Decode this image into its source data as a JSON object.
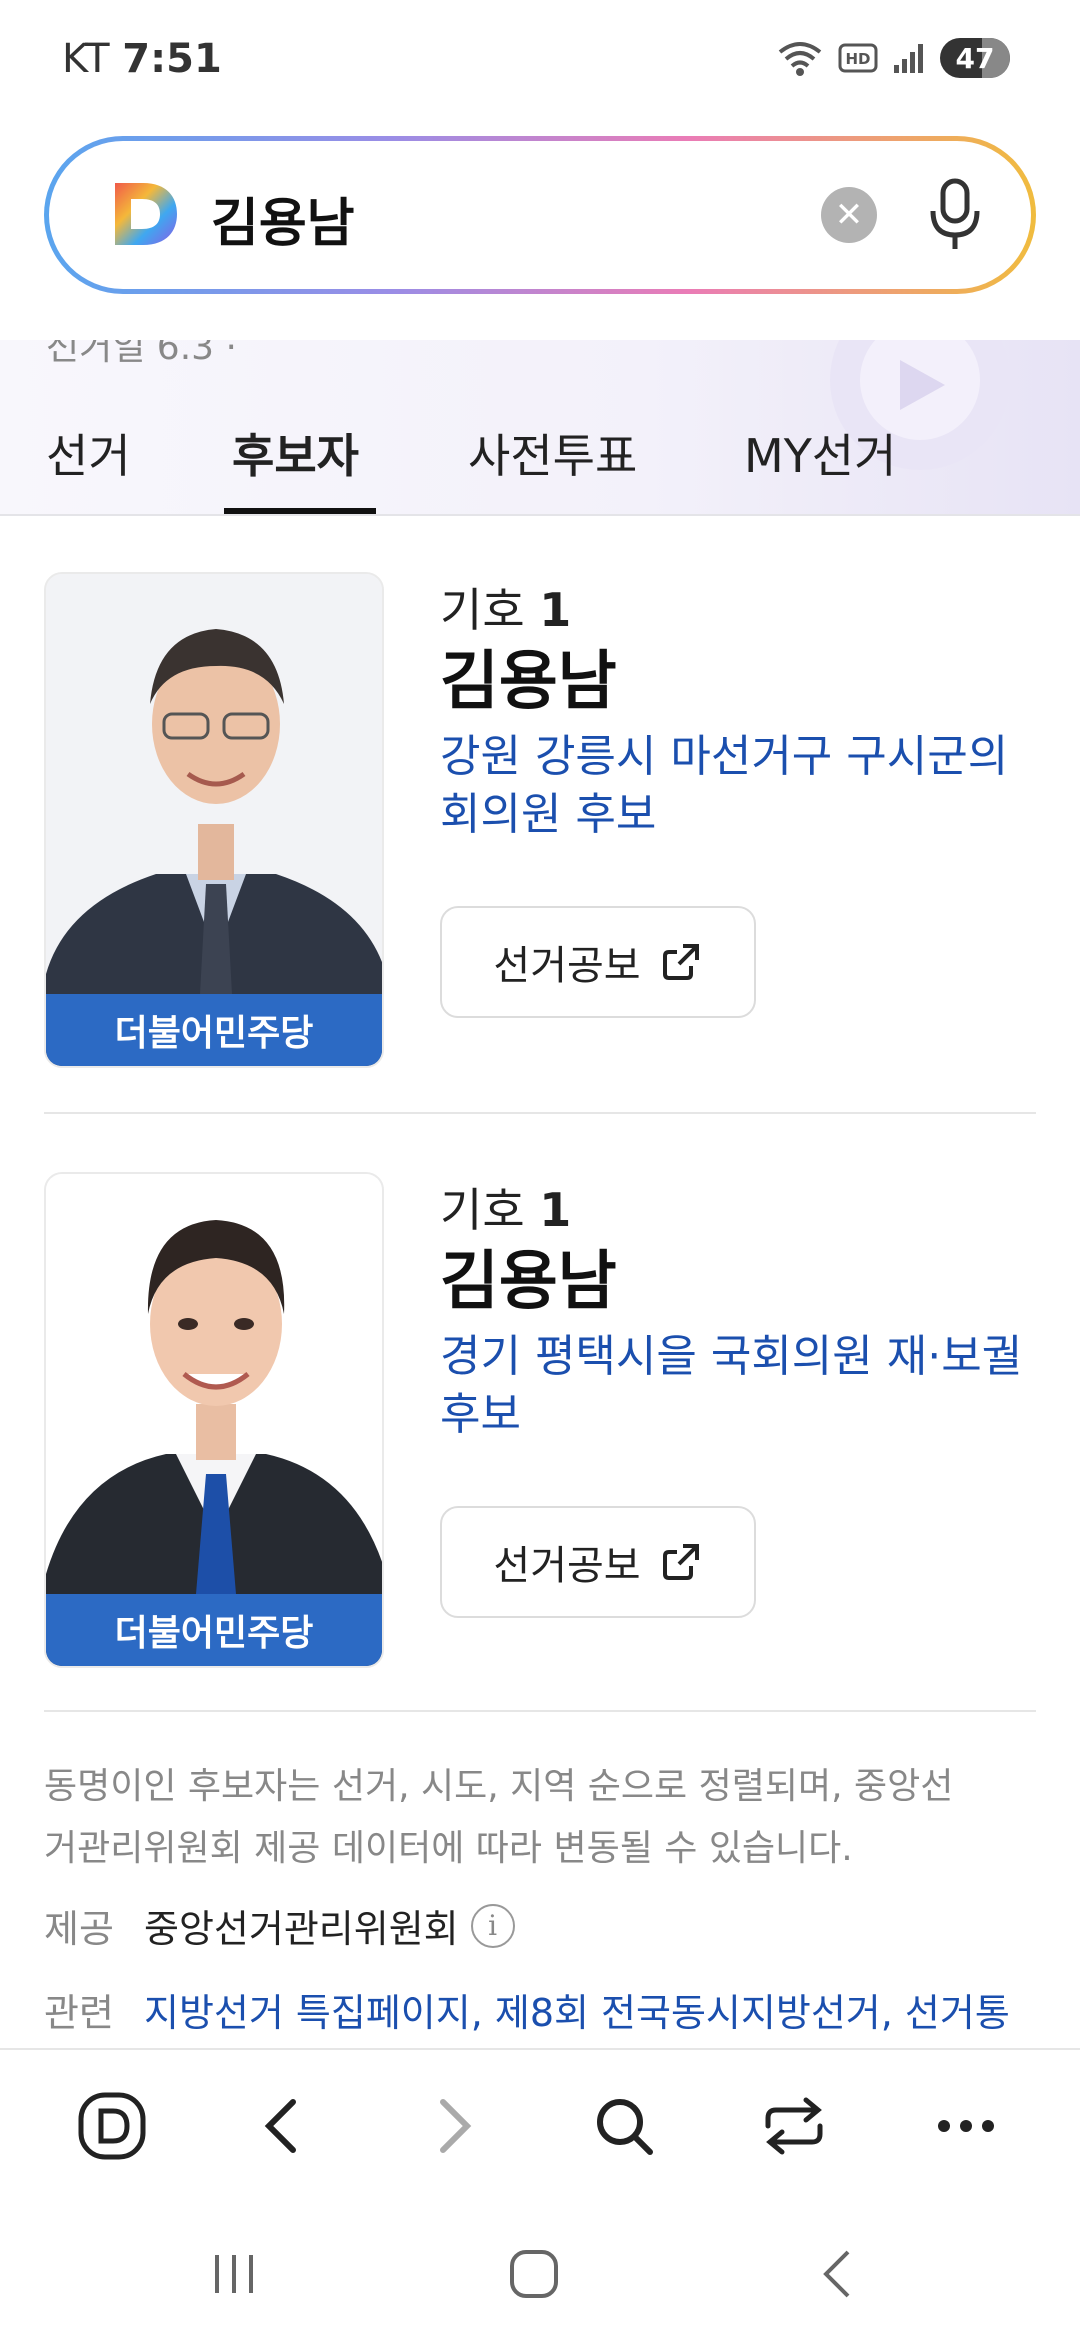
{
  "status_bar": {
    "carrier": "KT",
    "time": "7:51",
    "battery": "47"
  },
  "search": {
    "query": "김용남",
    "logo_letter": "D"
  },
  "banner": {
    "cut_text": "선거일 6.3 ·"
  },
  "tabs": [
    {
      "label": "선거",
      "active": false
    },
    {
      "label": "후보자",
      "active": true
    },
    {
      "label": "사전투표",
      "active": false
    },
    {
      "label": "MY선거",
      "active": false
    }
  ],
  "candidates": [
    {
      "number_label": "기호",
      "number": "1",
      "name": "김용남",
      "district_line1": "강원 강릉시 마선거구 구시군의",
      "district_line2": "회의원 후보",
      "party": "더불어민주당",
      "button_label": "선거공보"
    },
    {
      "number_label": "기호",
      "number": "1",
      "name": "김용남",
      "district_line1": "경기 평택시을 국회의원 재·보궐",
      "district_line2": "후보",
      "party": "더불어민주당",
      "button_label": "선거공보"
    }
  ],
  "footnote": {
    "text_line1": "동명이인 후보자는 선거, 시도, 지역 순으로 정렬되며, 중앙선",
    "text_line2": "거관리위원회 제공 데이터에 따라 변동될 수 있습니다.",
    "provider_label": "제공",
    "provider_value": "중앙선거관리위원회",
    "related_label": "관련",
    "related_links": "지방선거 특집페이지, 제8회 전국동시지방선거, 선거통"
  },
  "colors": {
    "party_blue": "#2c6ac4",
    "link_blue": "#1b4fae"
  },
  "icons": {
    "toolbar": [
      "daum-home-icon",
      "back-icon",
      "forward-icon",
      "search-icon",
      "tabs-switch-icon",
      "more-icon"
    ],
    "nav": [
      "recent-apps-icon",
      "home-icon",
      "nav-back-icon"
    ]
  }
}
